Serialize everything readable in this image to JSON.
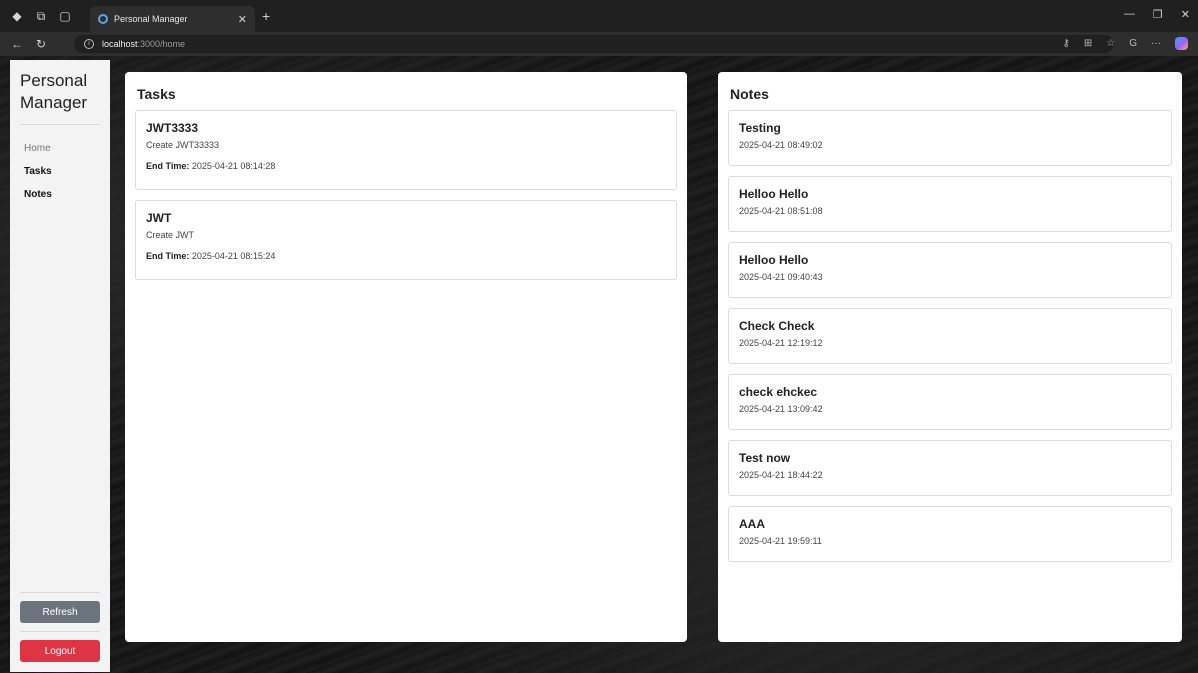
{
  "browser": {
    "tab_title": "Personal Manager",
    "url_host": "localhost",
    "url_path": ":3000/home"
  },
  "sidebar": {
    "brand": "Personal Manager",
    "nav": [
      "Home",
      "Tasks",
      "Notes"
    ],
    "refresh_label": "Refresh",
    "logout_label": "Logout"
  },
  "tasks": {
    "title": "Tasks",
    "end_time_label": "End Time:",
    "items": [
      {
        "title": "JWT3333",
        "description": "Create JWT33333",
        "end_time": "2025-04-21 08:14:28"
      },
      {
        "title": "JWT",
        "description": "Create JWT",
        "end_time": "2025-04-21 08:15:24"
      }
    ]
  },
  "notes": {
    "title": "Notes",
    "items": [
      {
        "title": "Testing",
        "time": "2025-04-21 08:49:02"
      },
      {
        "title": "Helloo Hello",
        "time": "2025-04-21 08:51:08"
      },
      {
        "title": "Helloo Hello",
        "time": "2025-04-21 09:40:43"
      },
      {
        "title": "Check Check",
        "time": "2025-04-21 12:19:12"
      },
      {
        "title": "check ehckec",
        "time": "2025-04-21 13:09:42"
      },
      {
        "title": "Test now",
        "time": "2025-04-21 18:44:22"
      },
      {
        "title": "AAA",
        "time": "2025-04-21 19:59:11"
      }
    ]
  },
  "colors": {
    "logout": "#dc3545",
    "refresh": "#6c757d"
  }
}
